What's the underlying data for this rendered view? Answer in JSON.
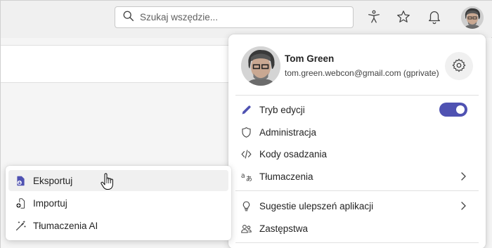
{
  "search": {
    "placeholder": "Szukaj wszędzie..."
  },
  "topbar_icons": [
    "accessibility-icon",
    "star-icon",
    "bell-icon"
  ],
  "profile": {
    "name": "Tom Green",
    "email": "tom.green.webcon@gmail.com (gprivate)",
    "settings_icon": "gear-icon"
  },
  "menu": {
    "items": [
      {
        "label": "Tryb edycji",
        "icon": "pencil-icon",
        "toggle_on": true
      },
      {
        "label": "Administracja",
        "icon": "shield-icon"
      },
      {
        "label": "Kody osadzania",
        "icon": "code-icon"
      },
      {
        "label": "Tłumaczenia",
        "icon": "translate-icon",
        "has_submenu": true
      },
      {
        "label": "Sugestie ulepszeń aplikacji",
        "icon": "lightbulb-icon",
        "has_submenu": true
      },
      {
        "label": "Zastępstwa",
        "icon": "people-icon"
      }
    ]
  },
  "submenu": {
    "items": [
      {
        "label": "Eksportuj",
        "icon": "document-export-icon",
        "hovered": true
      },
      {
        "label": "Importuj",
        "icon": "document-import-icon"
      },
      {
        "label": "Tłumaczenia AI",
        "icon": "magic-wand-icon"
      }
    ]
  },
  "colors": {
    "accent": "#4f52b2",
    "background": "#f0f0f0",
    "panel": "#ffffff"
  }
}
